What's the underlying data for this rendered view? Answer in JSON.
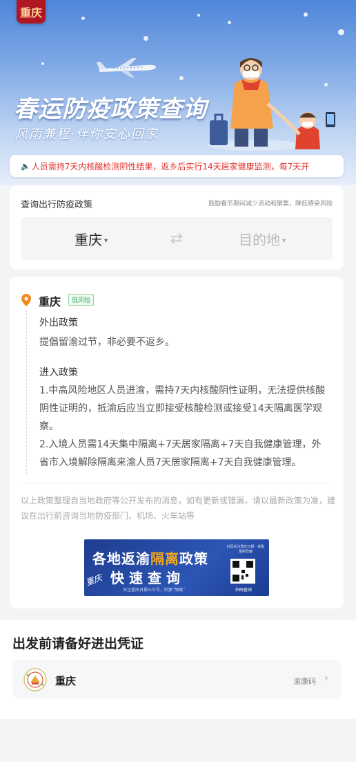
{
  "banner": {
    "logo_glyph": "重庆",
    "title": "春运防疫政策查询",
    "subtitle": "风雨兼程·伴你安心回家",
    "ticker_text": "人员需持7天内核酸检测阴性结果，返乡后实行14天居家健康监测，每7天开"
  },
  "query": {
    "label": "查询出行防疫政策",
    "tip": "鼓励春节期间减少流动和聚集，降低感染风险",
    "origin": "重庆",
    "destination_placeholder": "目的地"
  },
  "policy": {
    "city": "重庆",
    "risk_level": "低风险",
    "exit_heading": "外出政策",
    "exit_text": "提倡留渝过节，非必要不返乡。",
    "entry_heading": "进入政策",
    "entry_item_1": "1.中高风险地区人员进渝，需持7天内核酸阴性证明，无法提供核酸阴性证明的，抵渝后应当立即接受核酸检测或接受14天隔离医学观察。",
    "entry_item_2": "2.入境人员需14天集中隔离+7天居家隔离+7天自我健康管理，外省市入境解除隔离来渝人员7天居家隔离+7天自我健康管理。",
    "disclaimer": "以上政策整理自当地政府等公开发布的消息，如有更新或错漏，请以最新政策为准，建议在出行前咨询当地防疫部门、机场、火车站等"
  },
  "ad": {
    "line1_before": "各地返渝",
    "line1_highlight": "隔离",
    "line1_after": "政策",
    "line2": "快速查询",
    "note": "关注重庆日报公众号，回复“隔离”",
    "side_text": "扫码关注重庆日报 · 获取最新政策",
    "scan_label": "扫码查询",
    "signature": "重庆"
  },
  "credentials": {
    "title": "出发前请备好进出凭证",
    "city": "重庆",
    "code_label": "渝康码",
    "arrow": "›"
  },
  "colors": {
    "accent_red": "#e1312d",
    "risk_green": "#3aa657",
    "pin_orange": "#f08a24",
    "ad_blue": "#1e3d8f",
    "ad_highlight": "#f4a51c"
  },
  "icons": {
    "location": "location-pin-icon",
    "swap": "swap-arrows-icon",
    "speaker": "speaker-icon",
    "chevron": "chevron-right-icon",
    "emblem": "health-code-emblem-icon"
  }
}
